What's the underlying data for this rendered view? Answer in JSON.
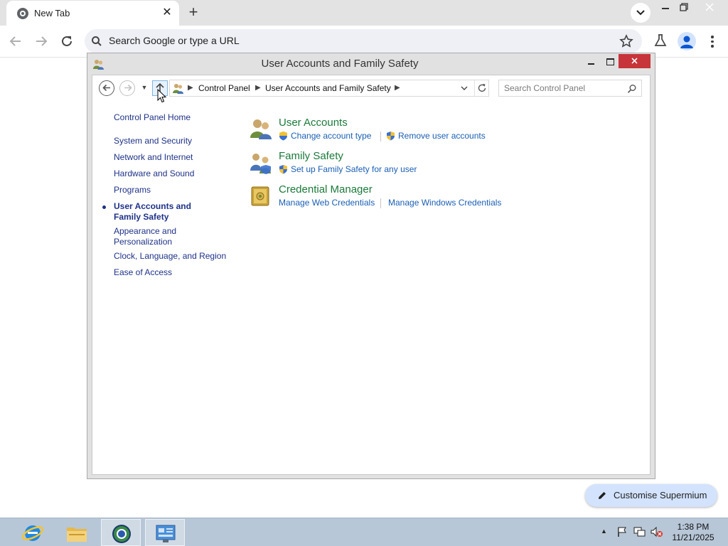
{
  "browser": {
    "tab_title": "New Tab",
    "omnibox_placeholder": "Search Google or type a URL",
    "customise_label": "Customise Supermium"
  },
  "cp_window": {
    "title": "User Accounts and Family Safety",
    "breadcrumbs": [
      "Control Panel",
      "User Accounts and Family Safety"
    ],
    "search_placeholder": "Search Control Panel",
    "nav": {
      "home": "Control Panel Home",
      "items": [
        {
          "label": "System and Security"
        },
        {
          "label": "Network and Internet"
        },
        {
          "label": "Hardware and Sound"
        },
        {
          "label": "Programs"
        },
        {
          "label": "User Accounts and Family Safety",
          "active": true
        },
        {
          "label": "Appearance and Personalization"
        },
        {
          "label": "Clock, Language, and Region"
        },
        {
          "label": "Ease of Access"
        }
      ]
    },
    "categories": [
      {
        "title": "User Accounts",
        "icon": "user-accounts-icon",
        "links": [
          "Change account type",
          "Remove user accounts"
        ]
      },
      {
        "title": "Family Safety",
        "icon": "family-safety-icon",
        "links": [
          "Set up Family Safety for any user"
        ]
      },
      {
        "title": "Credential Manager",
        "icon": "credential-manager-icon",
        "links": [
          "Manage Web Credentials",
          "Manage Windows Credentials"
        ]
      }
    ]
  },
  "taskbar": {
    "time": "1:38 PM",
    "date": "11/21/2025",
    "apps": [
      "internet-explorer-icon",
      "file-explorer-icon",
      "supermium-icon",
      "control-panel-icon"
    ]
  },
  "colors": {
    "category_title": "#1a7a3a",
    "link": "#1a5fb4",
    "nav_text": "#1e3287",
    "close_red": "#c7343a",
    "taskbar": "#b7c7d7"
  }
}
